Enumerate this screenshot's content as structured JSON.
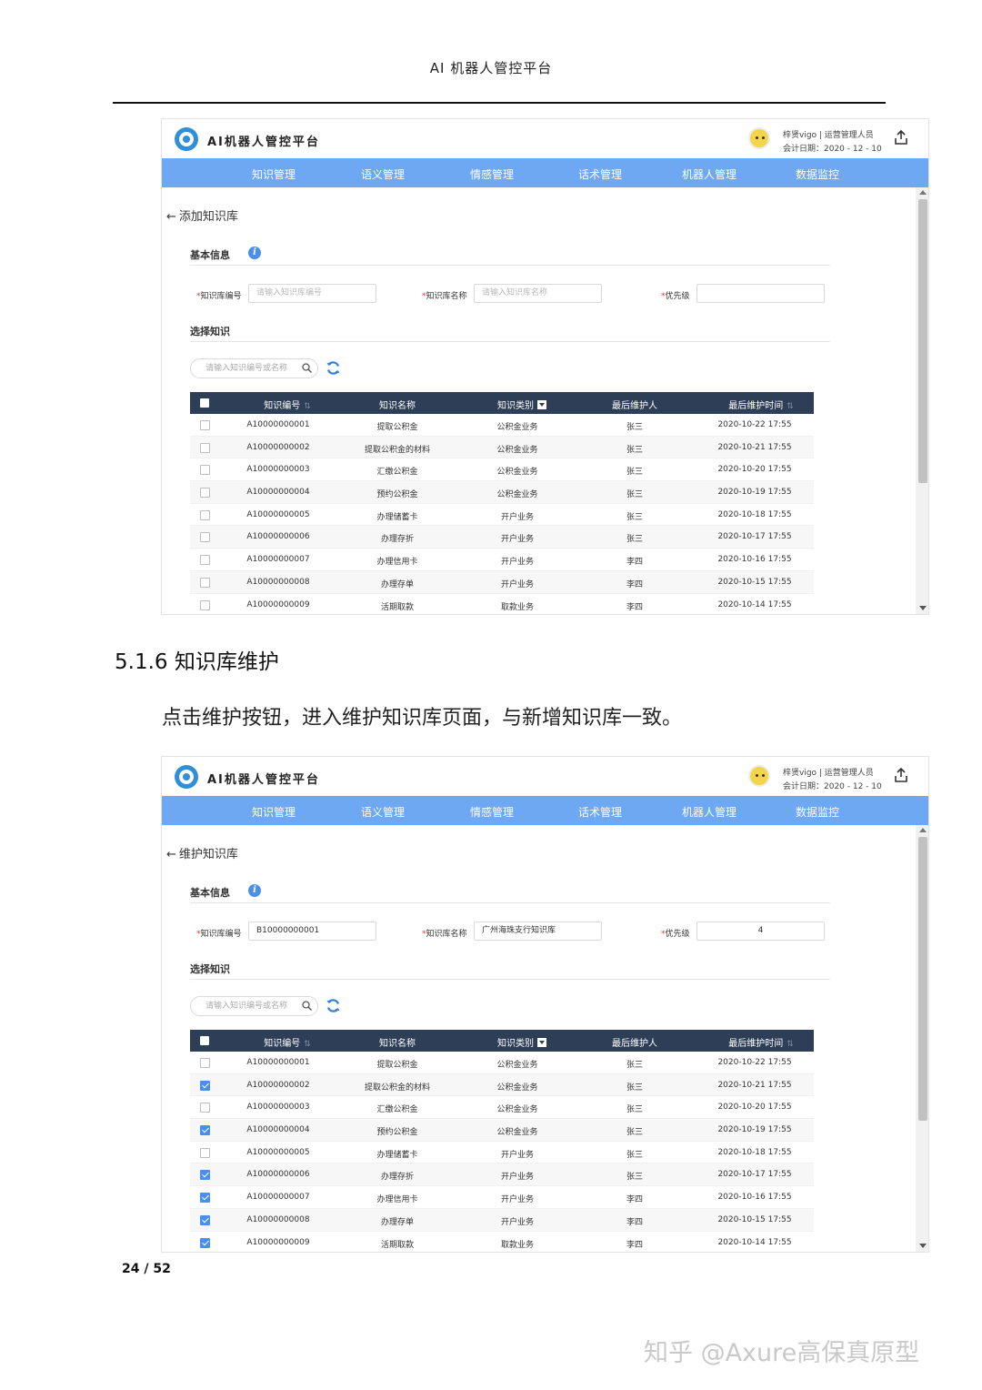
{
  "document": {
    "header": "AI 机器人管控平台",
    "section_heading": "5.1.6 知识库维护",
    "paragraph": "点击维护按钮，进入维护知识库页面，与新增知识库一致。",
    "page_number": "24 / 52",
    "watermark": "知乎 @Axure高保真原型"
  },
  "app": {
    "title": "AI机器人管控平台",
    "user_line1": "梓贤vigo | 运营管理人员",
    "user_line2": "会计日期：2020 - 12 - 10",
    "nav": [
      "知识管理",
      "语义管理",
      "情感管理",
      "话术管理",
      "机器人管理",
      "数据监控"
    ]
  },
  "screens": [
    {
      "back_label": "添加知识库",
      "basic_info_title": "基本信息",
      "select_title": "选择知识",
      "fields": {
        "code_label": "知识库编号",
        "code_value": "",
        "code_placeholder": "请输入知识库编号",
        "name_label": "知识库名称",
        "name_value": "",
        "name_placeholder": "请输入知识库名称",
        "priority_label": "优先级",
        "priority_value": ""
      },
      "search_placeholder": "请输入知识编号或名称",
      "checked": [
        false,
        false,
        false,
        false,
        false,
        false,
        false,
        false,
        false
      ]
    },
    {
      "back_label": "维护知识库",
      "basic_info_title": "基本信息",
      "select_title": "选择知识",
      "fields": {
        "code_label": "知识库编号",
        "code_value": "B10000000001",
        "code_placeholder": "",
        "name_label": "知识库名称",
        "name_value": "广州海珠支行知识库",
        "name_placeholder": "",
        "priority_label": "优先级",
        "priority_value": "4"
      },
      "search_placeholder": "请输入知识编号或名称",
      "checked": [
        false,
        true,
        false,
        true,
        false,
        true,
        true,
        true,
        true
      ]
    }
  ],
  "table": {
    "columns": [
      "知识编号",
      "知识名称",
      "知识类别",
      "最后维护人",
      "最后维护时间"
    ],
    "rows": [
      [
        "A10000000001",
        "提取公积金",
        "公积金业务",
        "张三",
        "2020-10-22 17:55"
      ],
      [
        "A10000000002",
        "提取公积金的材料",
        "公积金业务",
        "张三",
        "2020-10-21 17:55"
      ],
      [
        "A10000000003",
        "汇缴公积金",
        "公积金业务",
        "张三",
        "2020-10-20 17:55"
      ],
      [
        "A10000000004",
        "预约公积金",
        "公积金业务",
        "张三",
        "2020-10-19 17:55"
      ],
      [
        "A10000000005",
        "办理储蓄卡",
        "开户业务",
        "张三",
        "2020-10-18 17:55"
      ],
      [
        "A10000000006",
        "办理存折",
        "开户业务",
        "张三",
        "2020-10-17 17:55"
      ],
      [
        "A10000000007",
        "办理信用卡",
        "开户业务",
        "李四",
        "2020-10-16 17:55"
      ],
      [
        "A10000000008",
        "办理存单",
        "开户业务",
        "李四",
        "2020-10-15 17:55"
      ],
      [
        "A10000000009",
        "活期取款",
        "取款业务",
        "李四",
        "2020-10-14 17:55"
      ]
    ]
  },
  "icons": {
    "logo": "robot-platform-logo",
    "avatar": "user-avatar",
    "export": "export-upload-icon",
    "back": "arrow-left-icon",
    "info": "info-icon",
    "search": "search-icon",
    "refresh": "refresh-icon"
  },
  "colors": {
    "nav_bg": "#6ea7f2",
    "table_header_bg": "#2f3e57",
    "accent": "#4a8ef0"
  }
}
